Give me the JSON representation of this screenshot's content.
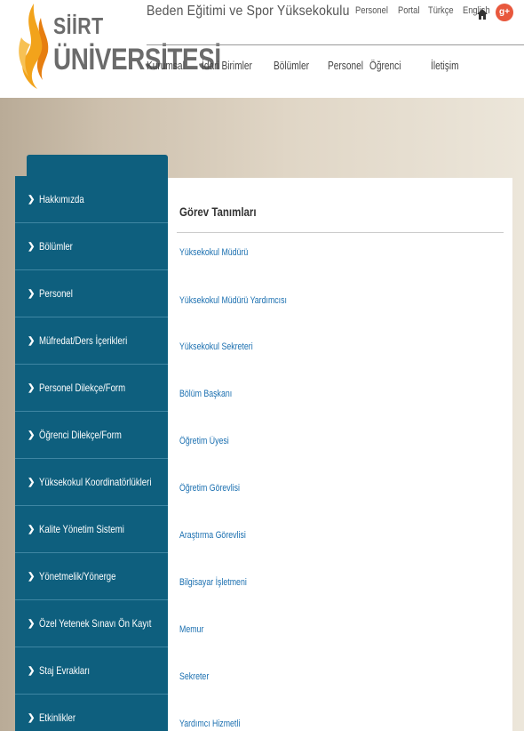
{
  "header": {
    "logo_line1": "SİİRT",
    "logo_line2": "ÜNİVERSİTESİ",
    "site_title": "Beden Eğitimi ve Spor Yüksekokulu",
    "top_links": [
      "Personel",
      "Portal",
      "Türkçe",
      "English"
    ],
    "nav": [
      "Kurumsal",
      "İdari Birimler",
      "Bölümler",
      "Personel",
      "Öğrenci",
      "İletişim"
    ],
    "gplus_label": "g+"
  },
  "sidebar": {
    "items": [
      "Hakkımızda",
      "Bölümler",
      "Personel",
      "Müfredat/Ders İçerikleri",
      "Personel Dilekçe/Form",
      "Öğrenci Dilekçe/Form",
      "Yüksekokul Koordinatörlükleri",
      "Kalite Yönetim Sistemi",
      "Yönetmelik/Yönerge",
      "Özel Yetenek Sınavı Ön Kayıt",
      "Staj Evrakları",
      "Etkinlikler"
    ]
  },
  "content": {
    "title": "Görev Tanımları",
    "links": [
      "Yüksekokul Müdürü",
      "Yüksekokul Müdürü Yardımcısı",
      "Yüksekokul Sekreteri",
      "Bölüm Başkanı",
      "Öğretim Üyesi",
      "Öğretim Görevlisi",
      "Araştırma Görevlisi",
      "Bilgisayar İşletmeni",
      "Memur",
      "Sekreter",
      "Yardımcı Hizmetli"
    ]
  },
  "colors": {
    "sidebar_bg": "#0e5f7e",
    "link": "#1a6fb0",
    "logo_flame": "#f2a31b"
  }
}
